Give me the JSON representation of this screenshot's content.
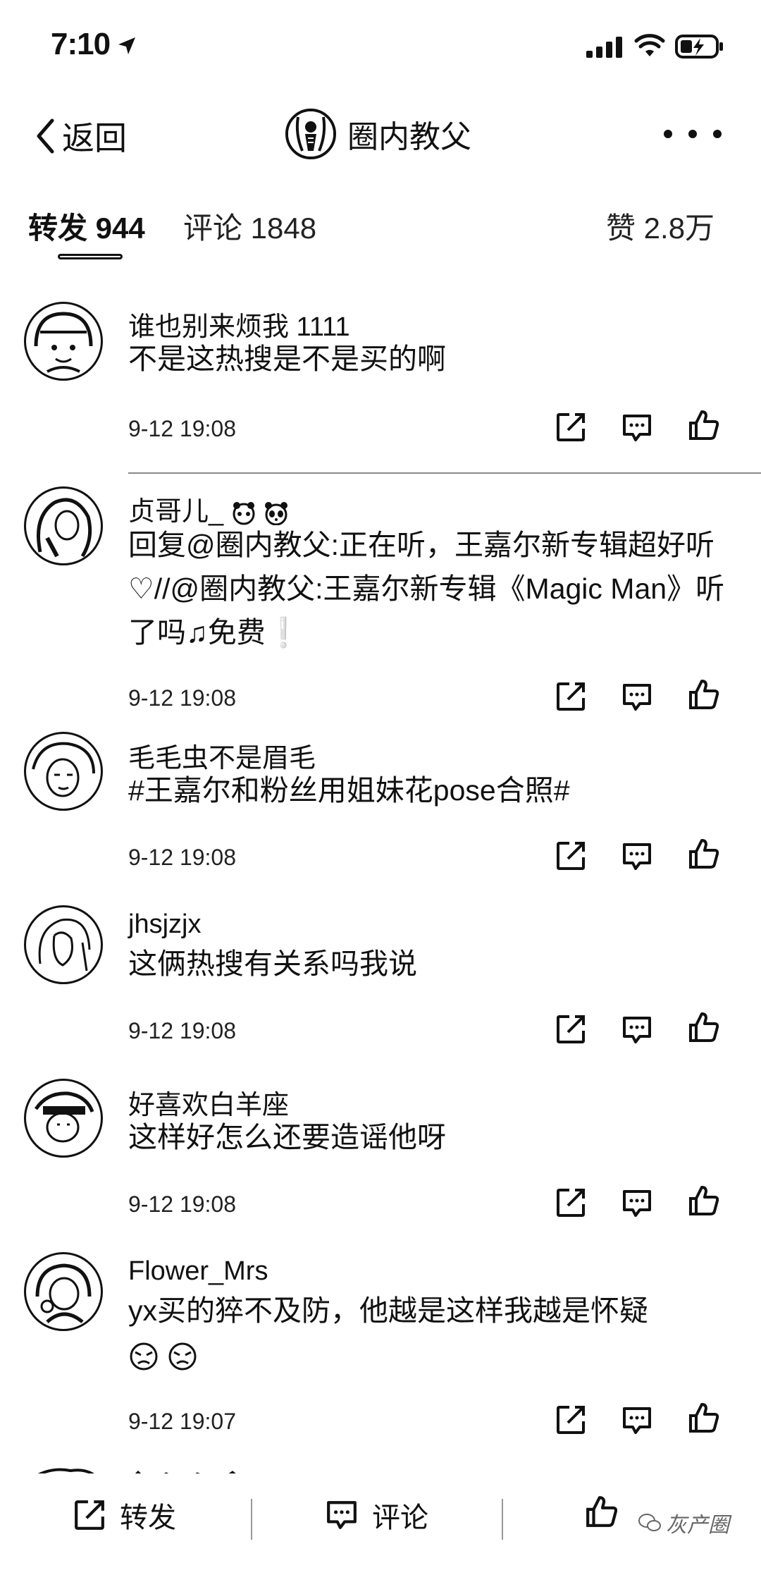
{
  "status": {
    "time": "7:10"
  },
  "nav": {
    "back_label": "返回",
    "title": "圈内教父"
  },
  "tabs": {
    "repost": "转发 944",
    "comment": "评论 1848",
    "like": "赞 2.8万"
  },
  "comments": [
    {
      "username": "谁也别来烦我 1111",
      "content": "不是这热搜是不是买的啊",
      "time": "9-12 19:08"
    },
    {
      "username": "贞哥儿_",
      "content": "回复@圈内教父:正在听，王嘉尔新专辑超好听 ♡//@圈内教父:王嘉尔新专辑《Magic Man》听了吗♫免费❕",
      "time": "9-12 19:08"
    },
    {
      "username": "毛毛虫不是眉毛",
      "content": "#王嘉尔和粉丝用姐妹花pose合照#",
      "time": "9-12 19:08"
    },
    {
      "username": "jhsjzjx",
      "content": "这俩热搜有关系吗我说",
      "time": "9-12 19:08"
    },
    {
      "username": "好喜欢白羊座",
      "content": "这样好怎么还要造谣他呀",
      "time": "9-12 19:08"
    },
    {
      "username": "Flower_Mrs",
      "content": "yx买的猝不及防，他越是这样我越是怀疑",
      "time": "9-12 19:07"
    }
  ],
  "bottom": {
    "repost": "转发",
    "comment": "评论",
    "watermark": "灰产圈"
  }
}
